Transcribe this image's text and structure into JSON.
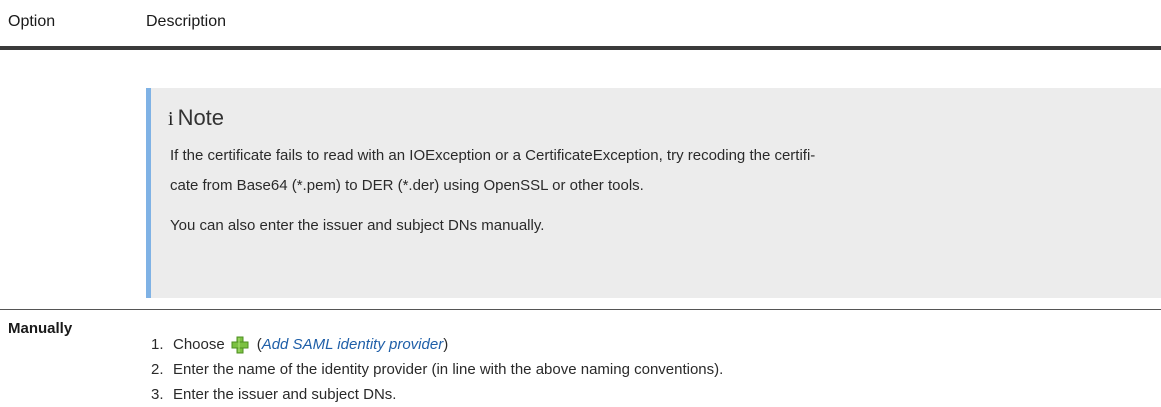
{
  "table": {
    "headers": {
      "option": "Option",
      "description": "Description"
    }
  },
  "note": {
    "icon": "info-icon",
    "icon_glyph": "i",
    "title": "Note",
    "paragraph1_line1": "If the certificate fails to read with an IOException or a CertificateException, try recoding the certifi-",
    "paragraph1_line2": "cate from Base64 (*.pem) to DER (*.der) using OpenSSL or other tools.",
    "paragraph2": "You can also enter the issuer and subject DNs manually.",
    "accent_color": "#7fb2e5",
    "background_color": "#ececec"
  },
  "manually_row": {
    "option": "Manually",
    "steps": [
      {
        "number": "1.",
        "prefix": "Choose",
        "icon": "add-plus-icon",
        "open_paren": "(",
        "link_text": "Add SAML identity provider",
        "close_paren": ")"
      },
      {
        "number": "2.",
        "text": "Enter the name of the identity provider (in line with the above naming conventions)."
      },
      {
        "number": "3.",
        "text": "Enter the issuer and subject DNs."
      }
    ],
    "link_color": "#1f5fa8",
    "icon_color": "#7cc142"
  }
}
